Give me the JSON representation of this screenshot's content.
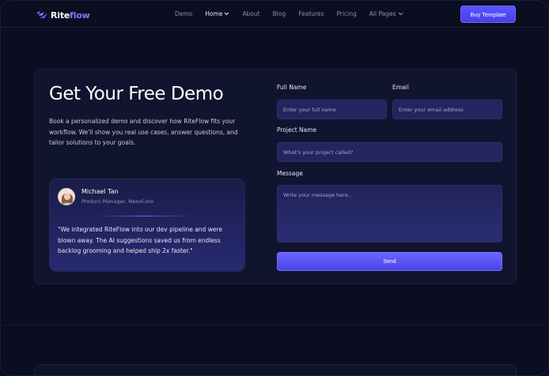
{
  "nav": {
    "logo_prefix": "Rite",
    "logo_suffix": "flow",
    "links": [
      {
        "label": "Demo"
      },
      {
        "label": "Home"
      },
      {
        "label": "About"
      },
      {
        "label": "Blog"
      },
      {
        "label": "Features"
      },
      {
        "label": "Pricing"
      },
      {
        "label": "All Pages"
      }
    ],
    "cta_label": "Buy Template"
  },
  "hero": {
    "title": "Get Your Free Demo",
    "intro": "Book a personalized demo and discover how RiteFlow fits your workflow. We'll show you real use cases, answer questions, and tailor solutions to your goals."
  },
  "testimonial": {
    "name": "Michael Tan",
    "role": "Product Manager, NexaCore",
    "quote": "\"We integrated RiteFlow into our dev pipeline and were blown away. The AI suggestions saved us from endless backlog grooming and helped ship 2x faster.\""
  },
  "form": {
    "full_name_label": "Full Name",
    "full_name_placeholder": "Enter your full name",
    "email_label": "Email",
    "email_placeholder": "Enter your email address",
    "project_label": "Project Name",
    "project_placeholder": "What's your project called?",
    "message_label": "Message",
    "message_placeholder": "Write your message here...",
    "send_label": "Send"
  },
  "colors": {
    "background": "#0b0d21",
    "accent": "#5a55ff",
    "card": "#11142e"
  }
}
